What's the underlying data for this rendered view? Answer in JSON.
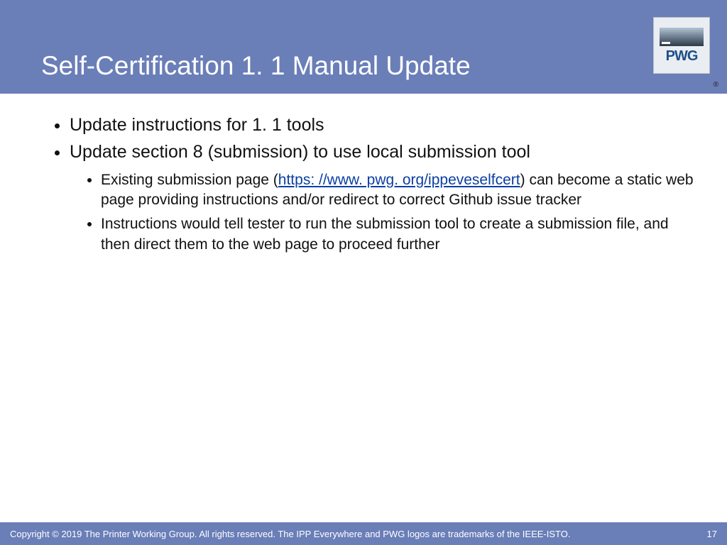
{
  "header": {
    "title": "Self-Certification 1. 1 Manual Update",
    "registered": "®"
  },
  "logo": {
    "text": "PWG"
  },
  "bullets": {
    "b1": "Update instructions for 1. 1 tools",
    "b2": "Update section 8 (submission) to use local submission tool",
    "sub1_pre": "Existing submission page (",
    "sub1_link": "https: //www. pwg. org/ippeveselfcert",
    "sub1_post": ") can become a static web page providing instructions and/or redirect to correct Github issue tracker",
    "sub2": "Instructions would tell tester to run the submission tool to create a submission file, and then direct them to the web page to proceed further"
  },
  "footer": {
    "copyright": "Copyright © 2019 The Printer Working Group. All rights reserved. The IPP Everywhere and PWG logos are trademarks of the IEEE-ISTO.",
    "page": "17"
  }
}
